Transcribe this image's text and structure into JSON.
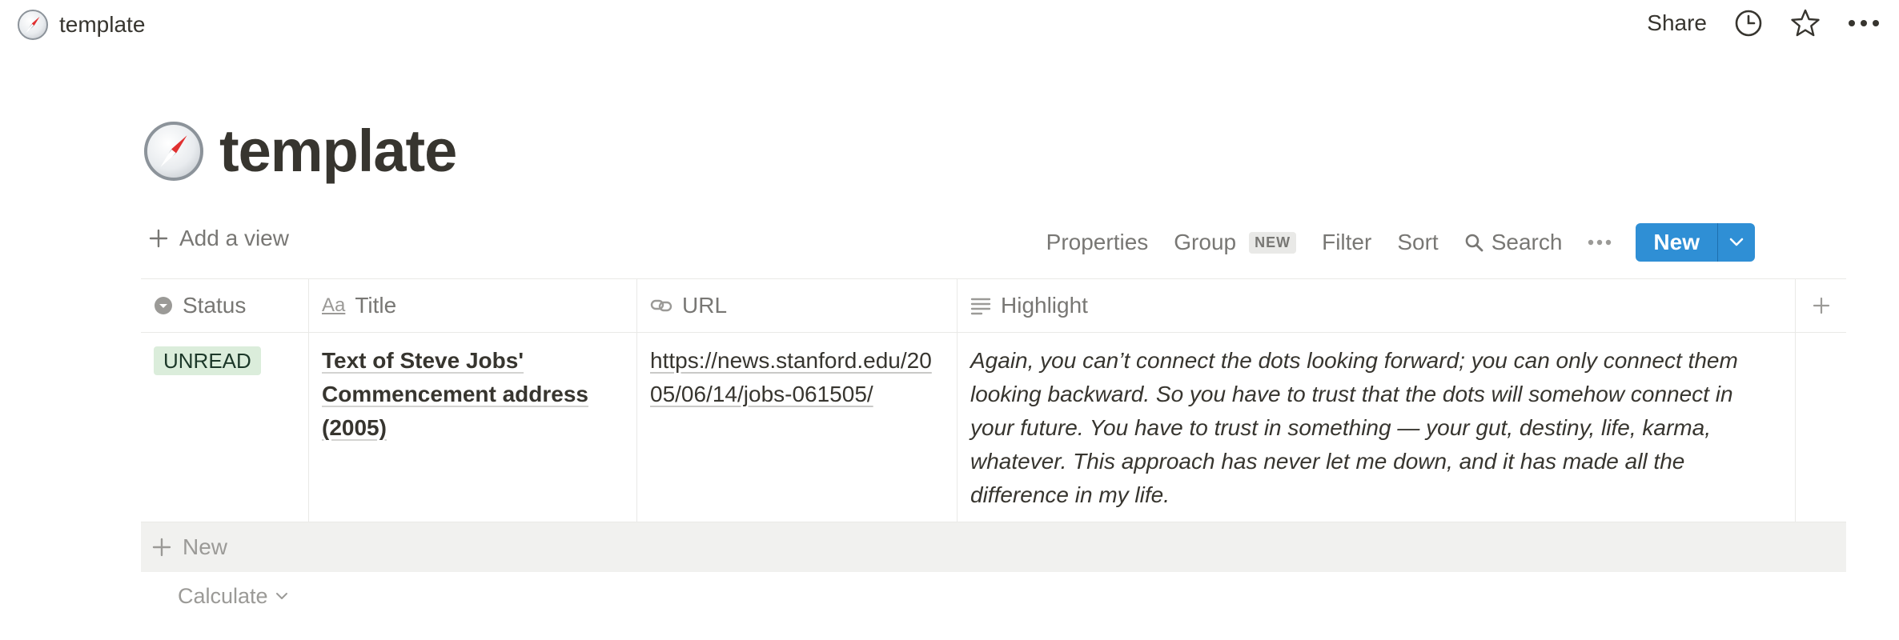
{
  "topbar": {
    "page_name": "template",
    "page_icon": "compass-emoji",
    "share_label": "Share",
    "actions": [
      "history-icon",
      "favorite-star-icon",
      "more-dots-icon"
    ]
  },
  "page": {
    "title": "template",
    "icon": "compass-emoji"
  },
  "toolbar": {
    "add_view_label": "Add a view",
    "properties_label": "Properties",
    "group_label": "Group",
    "group_badge": "NEW",
    "filter_label": "Filter",
    "sort_label": "Sort",
    "search_label": "Search",
    "new_label": "New",
    "accent_color": "#2F8FD5"
  },
  "table": {
    "columns": [
      {
        "label": "Status",
        "icon": "select-icon"
      },
      {
        "label": "Title",
        "icon": "text-aa-icon"
      },
      {
        "label": "URL",
        "icon": "link-icon"
      },
      {
        "label": "Highlight",
        "icon": "lines-icon"
      }
    ],
    "rows": [
      {
        "status": "UNREAD",
        "status_color": "#DBEDDB",
        "title": "Text of Steve Jobs' Commencement address (2005)",
        "url": "https://news.stanford.edu/2005/06/14/jobs-061505/",
        "highlight": "Again, you can’t connect the dots looking forward; you can only connect them looking backward. So you have to trust that the dots will somehow connect in your future. You have to trust in something — your gut, destiny, life, karma, whatever. This approach has never let me down, and it has made all the difference in my life."
      }
    ],
    "new_row_label": "New",
    "calculate_label": "Calculate"
  }
}
